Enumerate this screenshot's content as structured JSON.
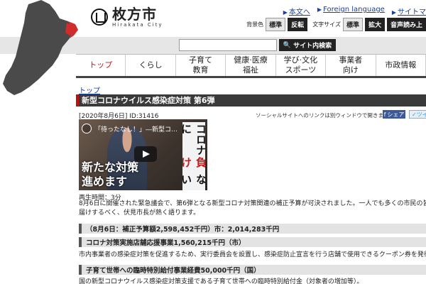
{
  "header": {
    "logo_jp": "枚方市",
    "logo_en": "Hirakata City",
    "links": [
      "本文へ",
      "Foreign language",
      "サイトマ"
    ],
    "settings": {
      "bg_label": "背景色",
      "bg_standard": "標準",
      "bg_invert": "反転",
      "size_label": "文字サイズ",
      "size_standard": "標準",
      "size_large": "拡大",
      "voice": "音声読み上"
    }
  },
  "search": {
    "button_label": "サイト内検索",
    "placeholder": ""
  },
  "nav": {
    "items": [
      "トップ",
      "くらし",
      "子育て\n教育",
      "健康·医療\n福祉",
      "学び·文化\nスポーツ",
      "事業者\n向け",
      "市政情報"
    ]
  },
  "breadcrumb": "トップ",
  "page": {
    "title": "新型コロナウイルス感染症対策 第6弾",
    "date": "[2020年8月6日]",
    "id": "ID:31416",
    "social_note": "ソーシャルサイトへのリンクは別ウィンドウで開きます",
    "fb_share": "シェア",
    "tw_share": "ツイ"
  },
  "video": {
    "title": "「待ったなし！」―新型コ…",
    "caption_main": "新たな対策\n進めます",
    "caption_vert_1": "コロナに",
    "caption_vert_red": "負け",
    "caption_vert_2": "ない"
  },
  "content": {
    "duration": "再生時間：3分",
    "lead_1": "8月6日に開催された緊急議会で、第6弾となる新型コロナ対策関連の補正予算が可決されました。一人でも多くの市民の皆さんに内容を",
    "lead_2": "届けするべく、伏見市長が熱く語ります。",
    "budget_bar": "（8月6日：補正予算額2,598,452千円）市：2,014,283千円",
    "section1_title": "コロナ対策実施店舗応援事業1,560,215千円（市）",
    "section1_body": "市内事業者の感染症対策を促進するため、実行委員会を設置し、感染症防止宣言を行う店舗で使用できるクーポン券を発行する。",
    "section2_title": "子育て世帯への臨時特別給付事業経費50,000千円（国）",
    "section2_body": "国の新型コロナウイルス感染症対策支援である子育て世帯への臨時特別給付金（対象者の増加等）。"
  }
}
